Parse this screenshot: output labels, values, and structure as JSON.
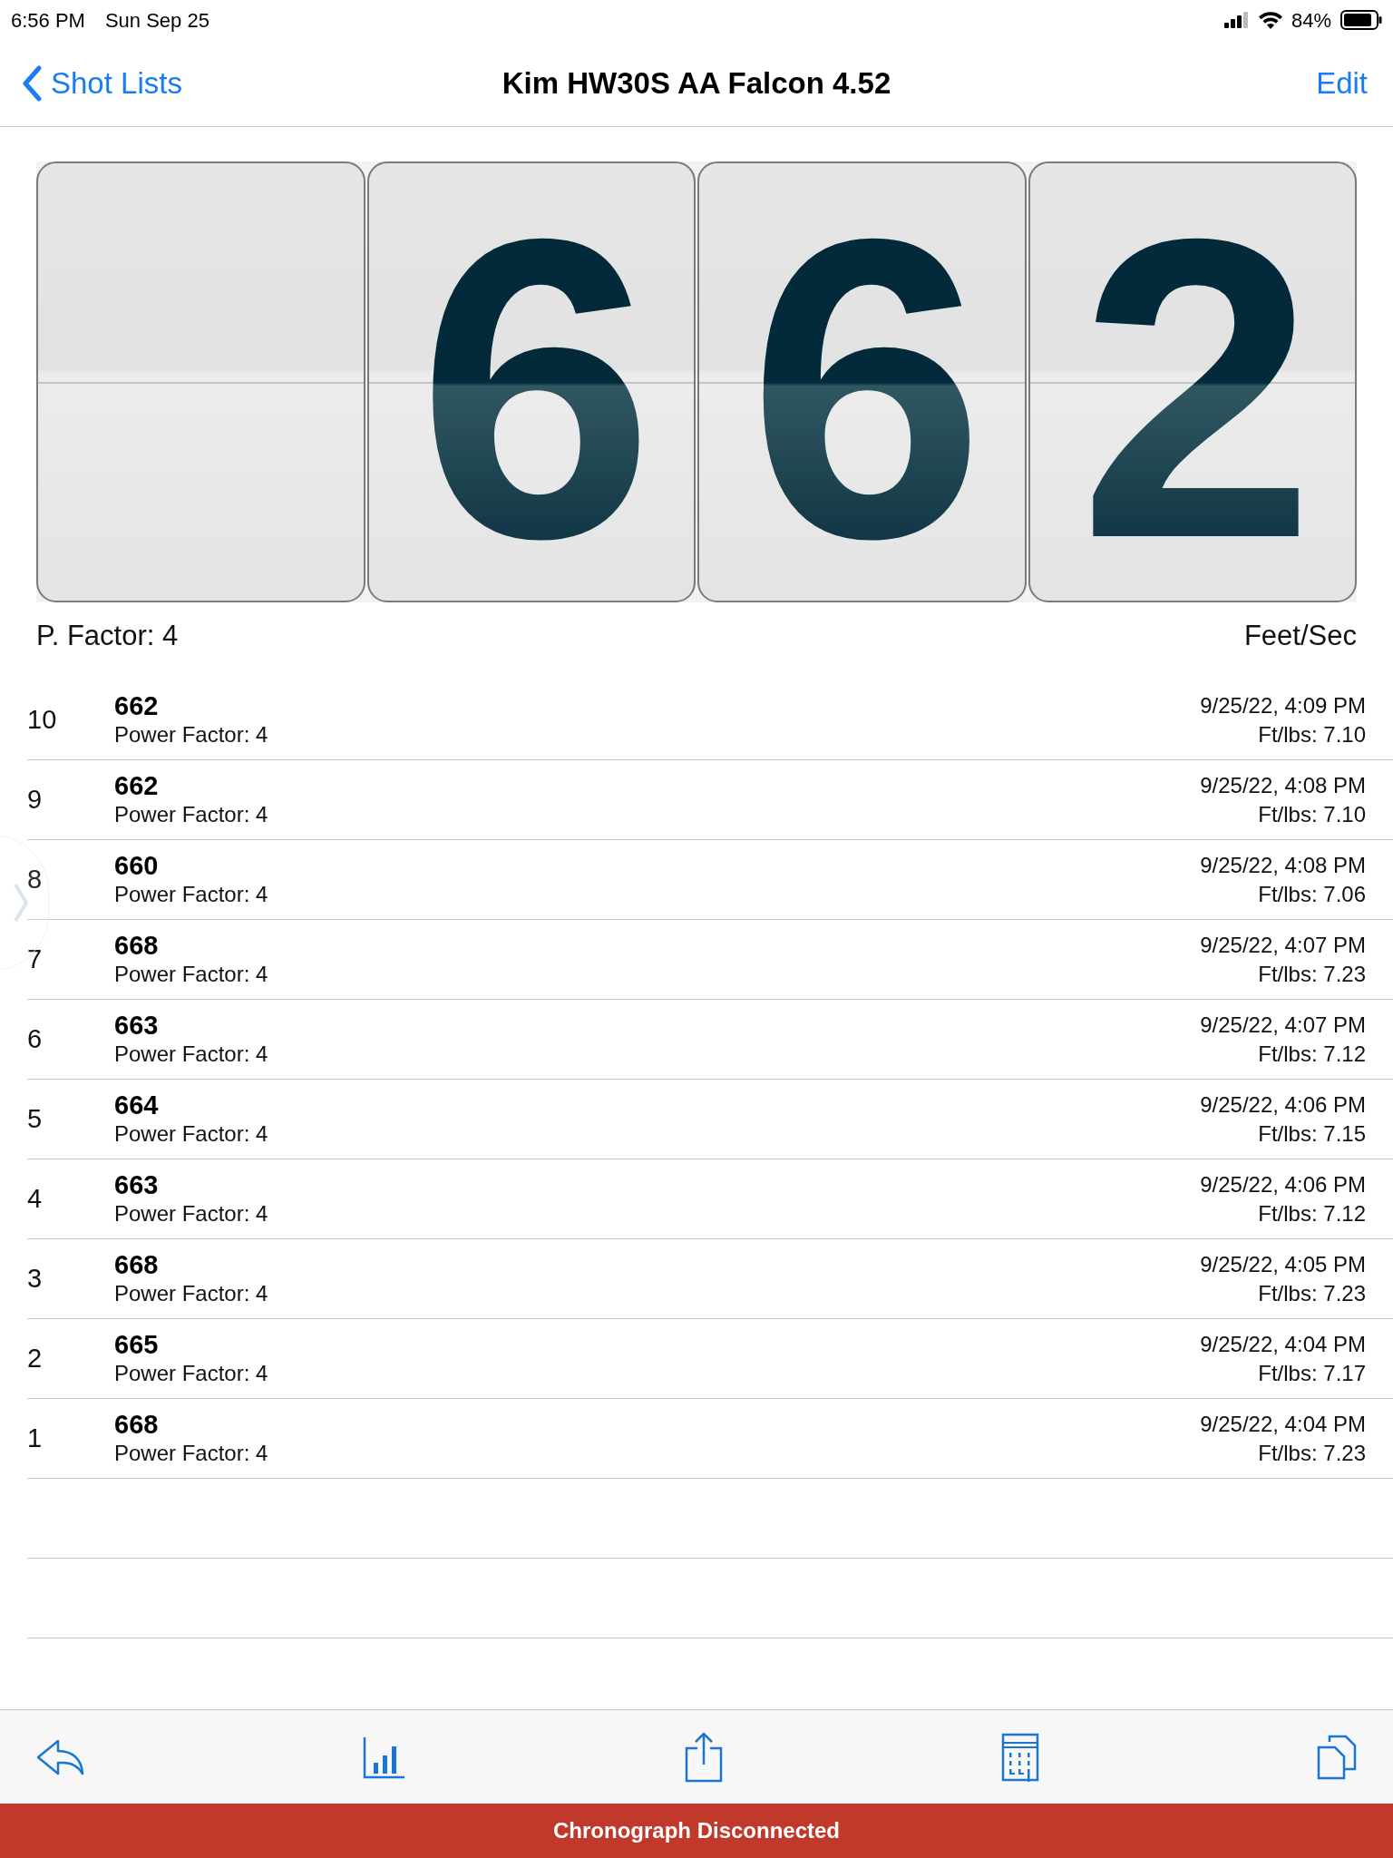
{
  "status_bar": {
    "time": "6:56 PM",
    "date": "Sun Sep 25",
    "battery": "84%"
  },
  "nav": {
    "back": "Shot Lists",
    "title": "Kim HW30S AA Falcon 4.52",
    "action": "Edit"
  },
  "display": {
    "digits": [
      "6",
      "6",
      "2"
    ],
    "power_factor": "P. Factor: 4",
    "unit": "Feet/Sec"
  },
  "shots": [
    {
      "index": "10",
      "speed": "662",
      "power_factor": "Power Factor: 4",
      "timestamp": "9/25/22, 4:09 PM",
      "energy": "Ft/lbs: 7.10"
    },
    {
      "index": "9",
      "speed": "662",
      "power_factor": "Power Factor: 4",
      "timestamp": "9/25/22, 4:08 PM",
      "energy": "Ft/lbs: 7.10"
    },
    {
      "index": "8",
      "speed": "660",
      "power_factor": "Power Factor: 4",
      "timestamp": "9/25/22, 4:08 PM",
      "energy": "Ft/lbs: 7.06"
    },
    {
      "index": "7",
      "speed": "668",
      "power_factor": "Power Factor: 4",
      "timestamp": "9/25/22, 4:07 PM",
      "energy": "Ft/lbs: 7.23"
    },
    {
      "index": "6",
      "speed": "663",
      "power_factor": "Power Factor: 4",
      "timestamp": "9/25/22, 4:07 PM",
      "energy": "Ft/lbs: 7.12"
    },
    {
      "index": "5",
      "speed": "664",
      "power_factor": "Power Factor: 4",
      "timestamp": "9/25/22, 4:06 PM",
      "energy": "Ft/lbs: 7.15"
    },
    {
      "index": "4",
      "speed": "663",
      "power_factor": "Power Factor: 4",
      "timestamp": "9/25/22, 4:06 PM",
      "energy": "Ft/lbs: 7.12"
    },
    {
      "index": "3",
      "speed": "668",
      "power_factor": "Power Factor: 4",
      "timestamp": "9/25/22, 4:05 PM",
      "energy": "Ft/lbs: 7.23"
    },
    {
      "index": "2",
      "speed": "665",
      "power_factor": "Power Factor: 4",
      "timestamp": "9/25/22, 4:04 PM",
      "energy": "Ft/lbs: 7.17"
    },
    {
      "index": "1",
      "speed": "668",
      "power_factor": "Power Factor: 4",
      "timestamp": "9/25/22, 4:04 PM",
      "energy": "Ft/lbs: 7.23"
    }
  ],
  "connection_banner": "Chronograph Disconnected"
}
